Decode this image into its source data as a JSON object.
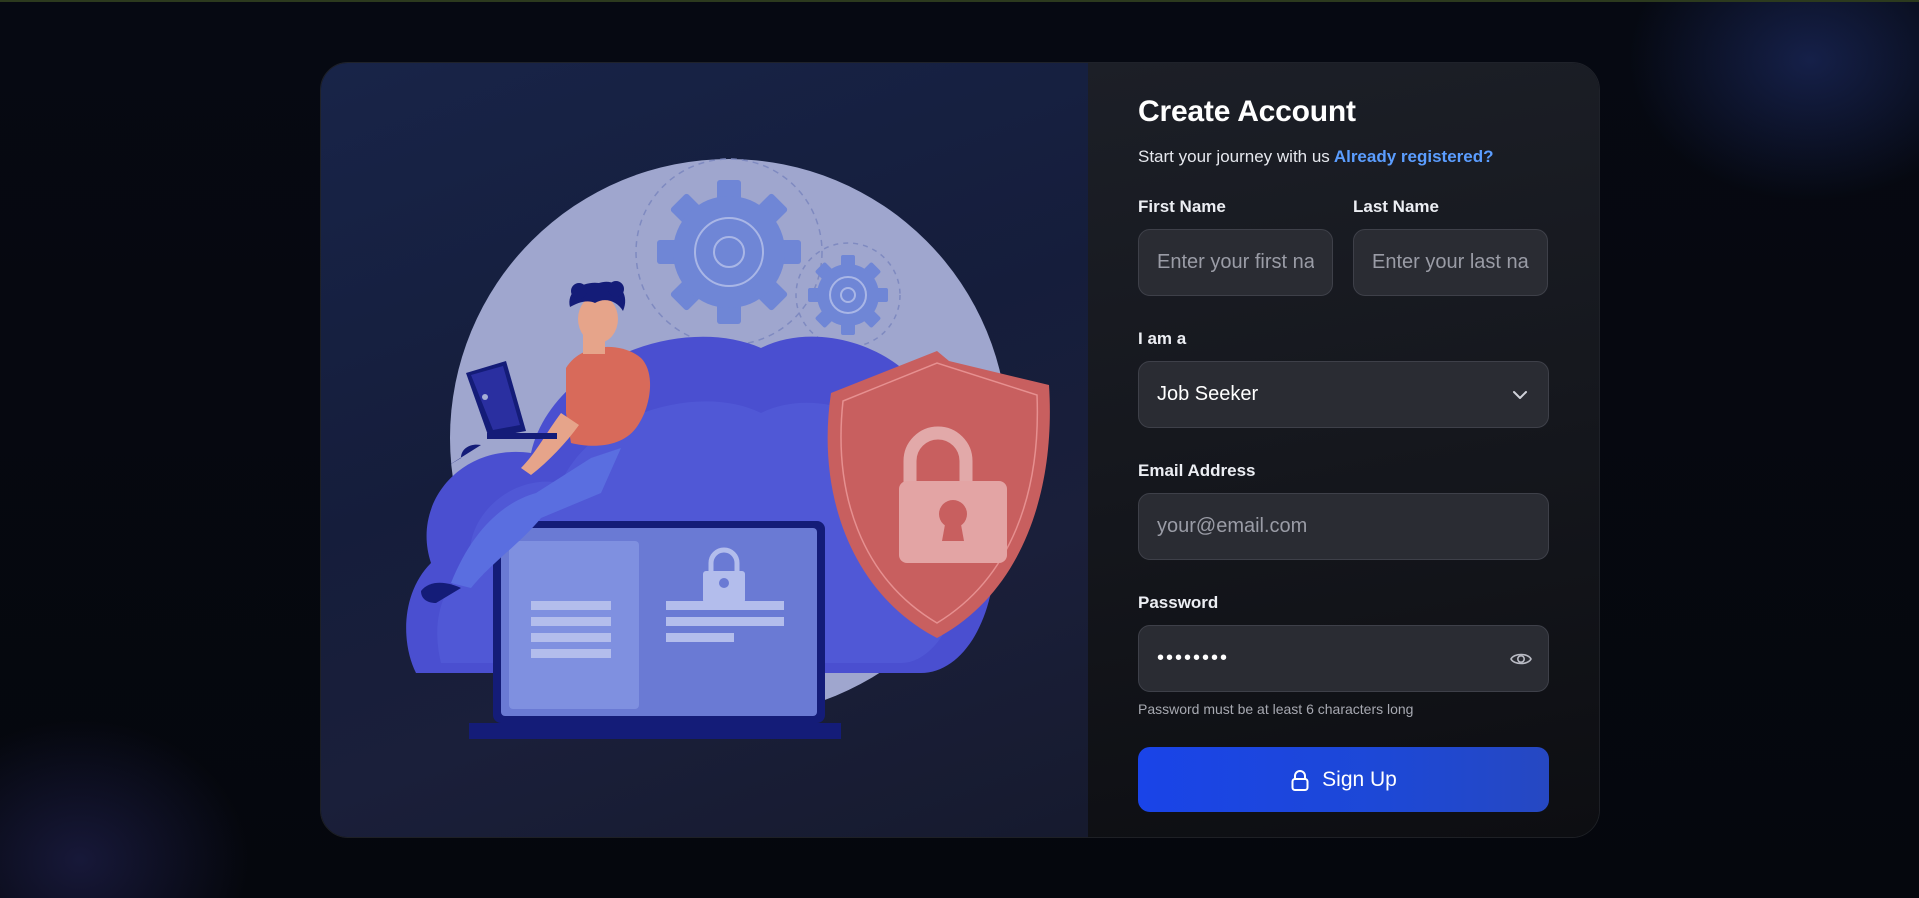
{
  "header": {
    "title": "Create Account",
    "subtitle": "Start your journey with us",
    "login_link": "Already registered?"
  },
  "form": {
    "first_name": {
      "label": "First Name",
      "placeholder": "Enter your first name",
      "value": ""
    },
    "last_name": {
      "label": "Last Name",
      "placeholder": "Enter your last name",
      "value": ""
    },
    "role": {
      "label": "I am a",
      "selected": "Job Seeker"
    },
    "email": {
      "label": "Email Address",
      "placeholder": "your@email.com",
      "value": ""
    },
    "password": {
      "label": "Password",
      "value": "••••••••",
      "hint": "Password must be at least 6 characters long"
    },
    "submit_label": "Sign Up"
  },
  "icons": {
    "illustration": "cloud-security-illustration",
    "role_dropdown": "chevron-down-icon",
    "password_toggle": "eye-icon",
    "submit": "lock-icon"
  },
  "colors": {
    "accent": "#1a44e8",
    "link": "#5b9dff",
    "shield": "#c85f5f"
  }
}
